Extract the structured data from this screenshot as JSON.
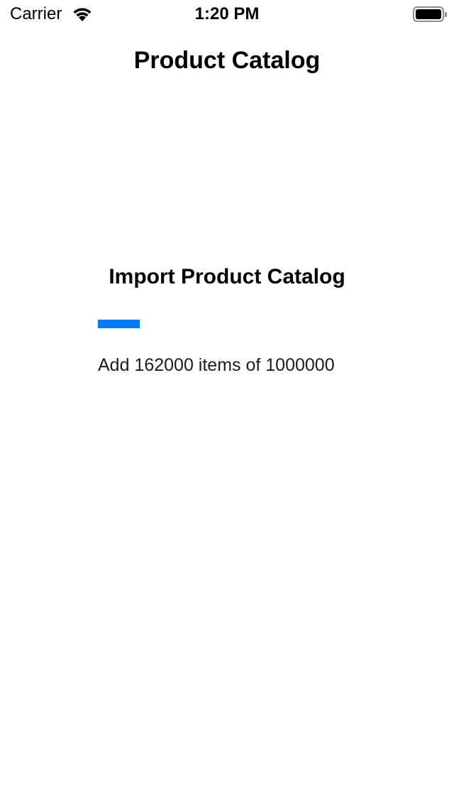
{
  "status_bar": {
    "carrier": "Carrier",
    "time": "1:20 PM",
    "wifi_icon": "wifi-icon",
    "battery_icon": "battery-icon"
  },
  "nav": {
    "title": "Product Catalog"
  },
  "import": {
    "title": "Import Product Catalog",
    "progress": 0.162,
    "status_text": "Add 162000 items of 1000000"
  },
  "colors": {
    "accent": "#007aff",
    "background": "#ffffff",
    "text": "#000000"
  }
}
